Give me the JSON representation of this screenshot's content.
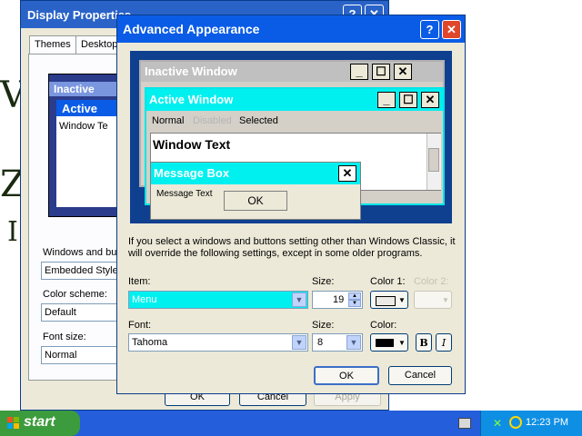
{
  "desktop": {
    "glyphs": [
      "V",
      "Z",
      "V",
      "Z",
      "I"
    ]
  },
  "display_properties": {
    "title": "Display Properties",
    "help_glyph": "?",
    "close_glyph": "✕",
    "tabs": [
      "Themes",
      "Desktop"
    ],
    "preview": {
      "inactive_title": "Inactive",
      "active_title": "Active",
      "window_text": "Window Te"
    },
    "windows_buttons_label": "Windows and but",
    "windows_buttons_value": "Embedded Style",
    "color_scheme_label": "Color scheme:",
    "color_scheme_value": "Default",
    "font_size_label": "Font size:",
    "font_size_value": "Normal",
    "buttons": {
      "ok": "OK",
      "cancel": "Cancel",
      "apply": "Apply"
    }
  },
  "advanced_appearance": {
    "title": "Advanced Appearance",
    "help_glyph": "?",
    "close_glyph": "✕",
    "preview": {
      "inactive_window_title": "Inactive Window",
      "active_window_title": "Active Window",
      "menu_normal": "Normal",
      "menu_disabled": "Disabled",
      "menu_selected": "Selected",
      "window_text": "Window Text",
      "message_box_title": "Message Box",
      "message_text": "Message Text",
      "ok": "OK",
      "minimize_glyph": "_",
      "maximize_glyph": "☐",
      "close_glyph": "✕"
    },
    "info_text": "If you select a windows and buttons setting other than Windows Classic, it will override the following settings, except in some older programs.",
    "item_label": "Item:",
    "item_value": "Menu",
    "size_label": "Size:",
    "size_value": "19",
    "color1_label": "Color 1:",
    "color2_label": "Color 2:",
    "font_label": "Font:",
    "font_value": "Tahoma",
    "font_size_label": "Size:",
    "font_size_value": "8",
    "font_color_label": "Color:",
    "bold_label": "B",
    "italic_label": "I",
    "ok": "OK",
    "cancel": "Cancel"
  },
  "taskbar": {
    "start_label": "start",
    "clock": "12:23 PM"
  },
  "colors": {
    "preview_cyan": "#00f0f0",
    "title_blue": "#0a5ce6",
    "taskbar_blue": "#245edb",
    "start_green": "#3c9b3c"
  }
}
